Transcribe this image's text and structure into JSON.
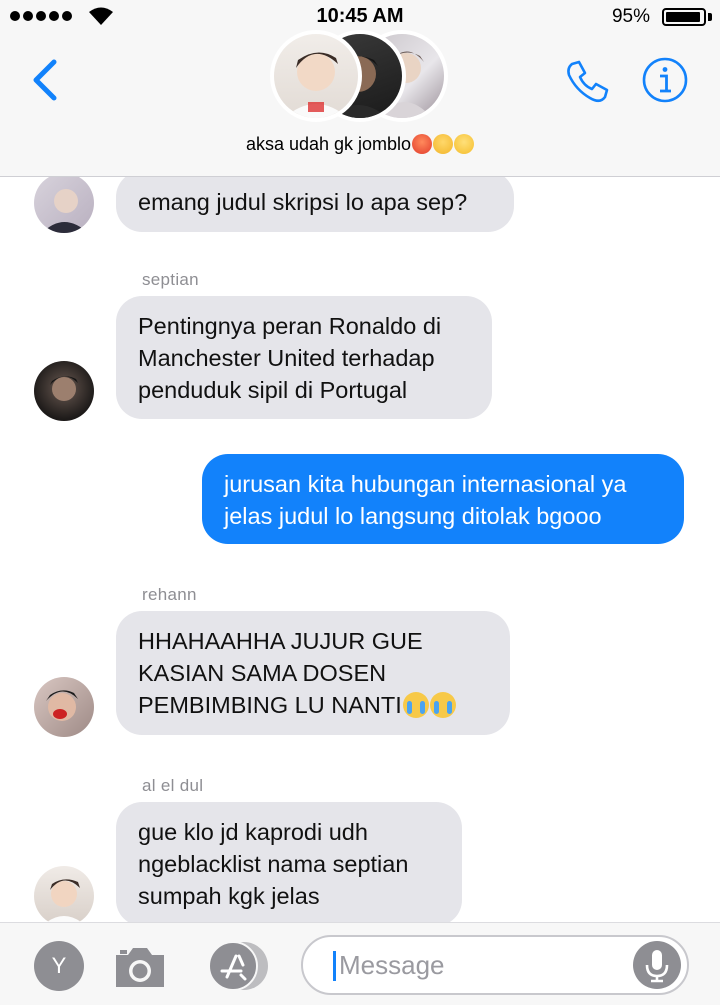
{
  "status_bar": {
    "time": "10:45 AM",
    "battery_percent": "95%",
    "battery_level": 0.95,
    "signal_bars": 5
  },
  "header": {
    "group_name": "aksa udah gk jomblo",
    "group_emojis": [
      "hot-face",
      "partying-face",
      "star-struck"
    ]
  },
  "messages": [
    {
      "sender": "",
      "text": "emang judul skripsi lo apa sep?",
      "outgoing": false
    },
    {
      "sender": "septian",
      "text": "Pentingnya peran Ronaldo di Manchester United terhadap penduduk sipil di Portugal",
      "outgoing": false
    },
    {
      "sender": "",
      "text": "jurusan kita hubungan internasional ya jelas judul lo langsung ditolak bgooo",
      "outgoing": true
    },
    {
      "sender": "rehann",
      "text": "HHAHAAHHA JUJUR GUE KASIAN SAMA DOSEN PEMBIMBING LU NANTI",
      "outgoing": false,
      "emojis": [
        "loudly-crying-face",
        "loudly-crying-face"
      ]
    },
    {
      "sender": "al el dul",
      "text": "gue klo jd kaprodi udh ngeblacklist nama septian sumpah kgk jelas",
      "outgoing": false
    }
  ],
  "input_bar": {
    "app_button_label": "Y",
    "placeholder": "Message"
  },
  "colors": {
    "accent": "#1282fb",
    "incoming_bubble": "#e5e5ea",
    "outgoing_bubble": "#1282fb",
    "sender_name": "#8e8e93"
  }
}
